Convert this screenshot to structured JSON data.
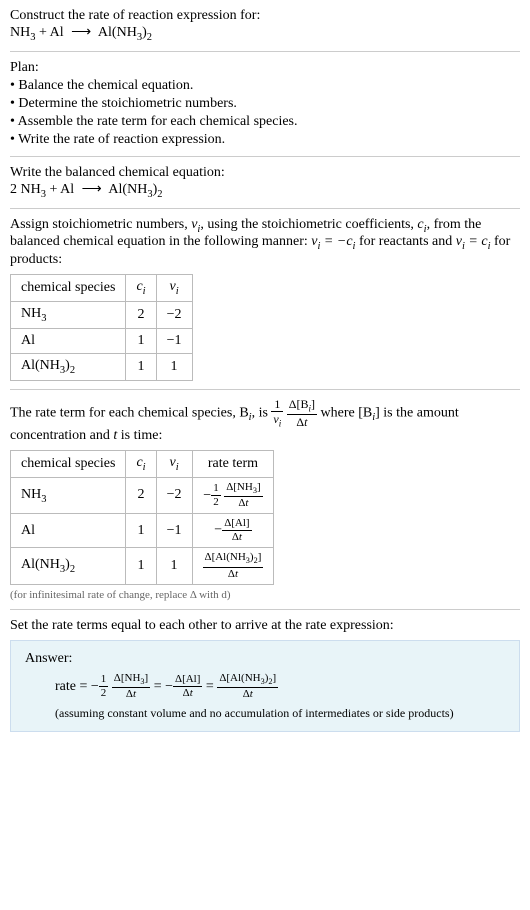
{
  "intro": {
    "prompt": "Construct the rate of reaction expression for:",
    "equation_lhs": "NH",
    "equation_plus": " + Al ",
    "equation_arrow": "⟶",
    "equation_rhs": " Al(NH",
    "equation_rhs2": ")"
  },
  "plan": {
    "heading": "Plan:",
    "items": [
      "• Balance the chemical equation.",
      "• Determine the stoichiometric numbers.",
      "• Assemble the rate term for each chemical species.",
      "• Write the rate of reaction expression."
    ]
  },
  "balanced": {
    "heading": "Write the balanced chemical equation:",
    "coef1": "2 NH",
    "mid": " + Al ",
    "arrow": "⟶",
    "rhs": " Al(NH",
    "rhs2": ")"
  },
  "stoich": {
    "text1": "Assign stoichiometric numbers, ",
    "nu_i": "ν",
    "text2": ", using the stoichiometric coefficients, ",
    "c_i": "c",
    "text3": ", from the balanced chemical equation in the following manner: ",
    "rel1": "ν",
    "rel1b": " = −c",
    "text4": " for reactants and ",
    "rel2": "ν",
    "rel2b": " = c",
    "text5": " for products:",
    "table": {
      "headers": [
        "chemical species",
        "cᵢ",
        "νᵢ"
      ],
      "rows": [
        {
          "species": "NH₃",
          "c": "2",
          "nu": "−2"
        },
        {
          "species": "Al",
          "c": "1",
          "nu": "−1"
        },
        {
          "species": "Al(NH₃)₂",
          "c": "1",
          "nu": "1"
        }
      ]
    }
  },
  "rateterm": {
    "text1": "The rate term for each chemical species, B",
    "text2": ", is ",
    "text3": " where [B",
    "text4": "] is the amount concentration and ",
    "t": "t",
    "text5": " is time:",
    "table": {
      "headers": [
        "chemical species",
        "cᵢ",
        "νᵢ",
        "rate term"
      ],
      "rows": [
        {
          "species": "NH₃",
          "c": "2",
          "nu": "−2"
        },
        {
          "species": "Al",
          "c": "1",
          "nu": "−1"
        },
        {
          "species": "Al(NH₃)₂",
          "c": "1",
          "nu": "1"
        }
      ]
    },
    "note": "(for infinitesimal rate of change, replace Δ with d)"
  },
  "final": {
    "heading": "Set the rate terms equal to each other to arrive at the rate expression:"
  },
  "answer": {
    "label": "Answer:",
    "rate_prefix": "rate = ",
    "assume": "(assuming constant volume and no accumulation of intermediates or side products)"
  },
  "chart_data": {
    "type": "table",
    "tables": [
      {
        "title": "Stoichiometric numbers",
        "headers": [
          "chemical species",
          "c_i",
          "nu_i"
        ],
        "rows": [
          [
            "NH3",
            2,
            -2
          ],
          [
            "Al",
            1,
            -1
          ],
          [
            "Al(NH3)2",
            1,
            1
          ]
        ]
      },
      {
        "title": "Rate terms",
        "headers": [
          "chemical species",
          "c_i",
          "nu_i",
          "rate term"
        ],
        "rows": [
          [
            "NH3",
            2,
            -2,
            "-(1/2) Δ[NH3]/Δt"
          ],
          [
            "Al",
            1,
            -1,
            "-Δ[Al]/Δt"
          ],
          [
            "Al(NH3)2",
            1,
            1,
            "Δ[Al(NH3)2]/Δt"
          ]
        ]
      }
    ],
    "rate_expression": "rate = -(1/2) Δ[NH3]/Δt = -Δ[Al]/Δt = Δ[Al(NH3)2]/Δt"
  }
}
